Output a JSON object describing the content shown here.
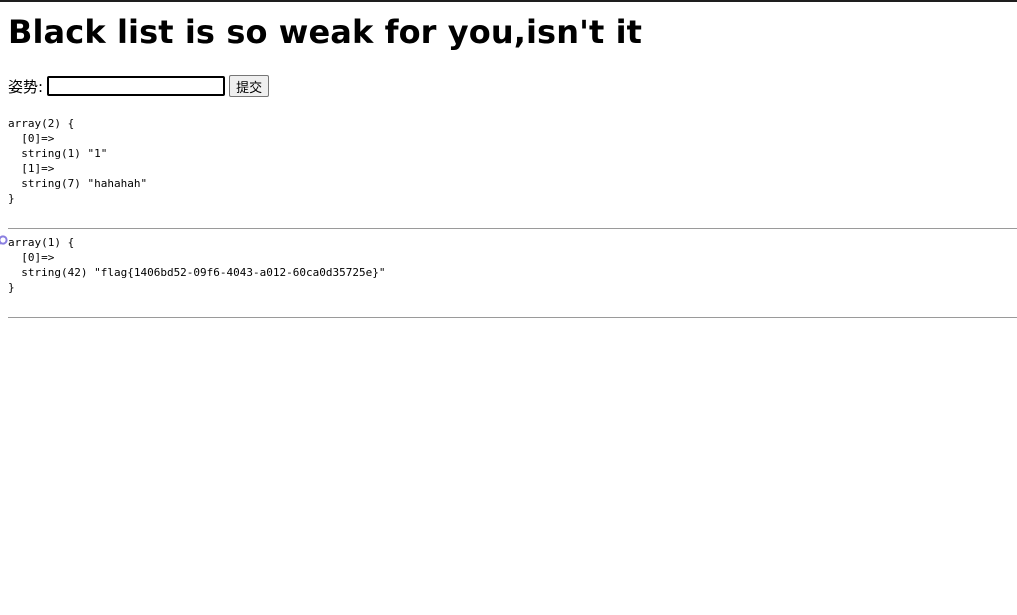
{
  "page": {
    "title": "Black list is so weak for you,isn't it"
  },
  "form": {
    "label": "姿势:",
    "input_value": "",
    "submit_label": "提交"
  },
  "output": {
    "dump1": "array(2) {\n  [0]=>\n  string(1) \"1\"\n  [1]=>\n  string(7) \"hahahah\"\n}",
    "dump2": "array(1) {\n  [0]=>\n  string(42) \"flag{1406bd52-09f6-4043-a012-60ca0d35725e}\"\n}"
  },
  "colors": {
    "cursor": "#8a7fe0"
  }
}
